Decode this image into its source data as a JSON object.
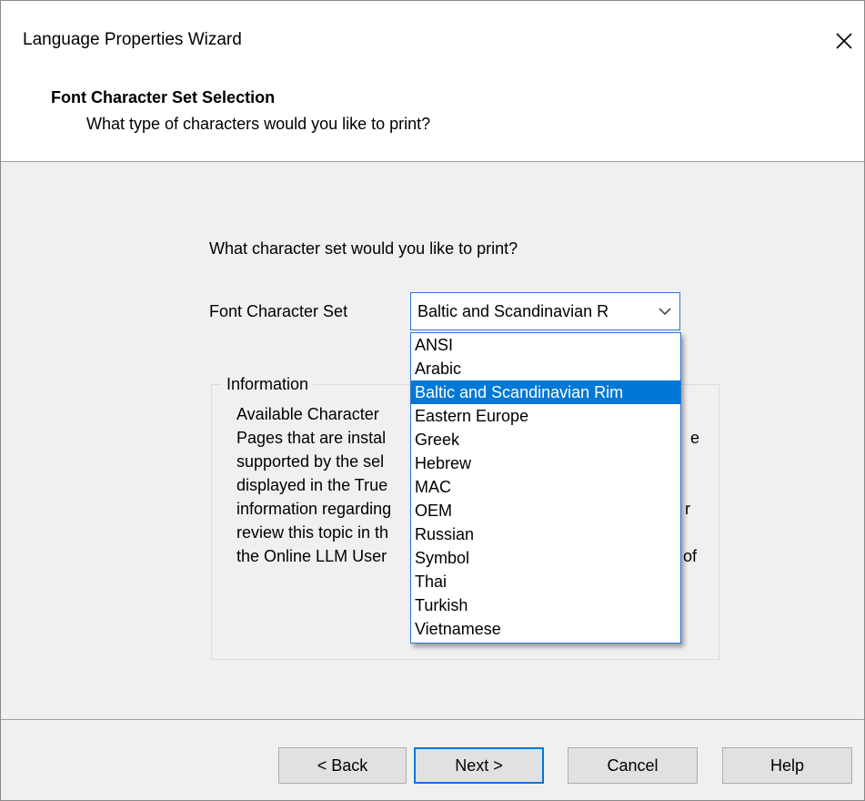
{
  "window": {
    "title": "Language Properties Wizard"
  },
  "header": {
    "title": "Font Character Set Selection",
    "subtitle": "What type of characters would you like to print?"
  },
  "body": {
    "question": "What character set would you like to print?",
    "field_label": "Font Character Set",
    "combo_value": "Baltic and Scandinavian R",
    "info_group_label": "Information",
    "info_lines": [
      "Available Character",
      "Pages that are instal",
      "supported by the sel",
      "displayed in the True",
      "information regarding",
      "review this topic in th",
      "the Online LLM User"
    ],
    "info_line_tails": [
      "",
      "e",
      "",
      "",
      "r",
      "of",
      ""
    ]
  },
  "dropdown": {
    "options": [
      "ANSI",
      "Arabic",
      "Baltic and Scandinavian Rim",
      "Eastern Europe",
      "Greek",
      "Hebrew",
      "MAC",
      "OEM",
      "Russian",
      "Symbol",
      "Thai",
      "Turkish",
      "Vietnamese"
    ],
    "selected_index": 2
  },
  "buttons": {
    "back": "< Back",
    "next": "Next >",
    "cancel": "Cancel",
    "help": "Help"
  },
  "colors": {
    "highlight": "#0078d7",
    "focus_border": "#2b74d6",
    "dialog_bg": "#f0f0f0"
  },
  "icons": {
    "close": "close-icon",
    "dropdown_arrow": "chevron-down-icon"
  }
}
